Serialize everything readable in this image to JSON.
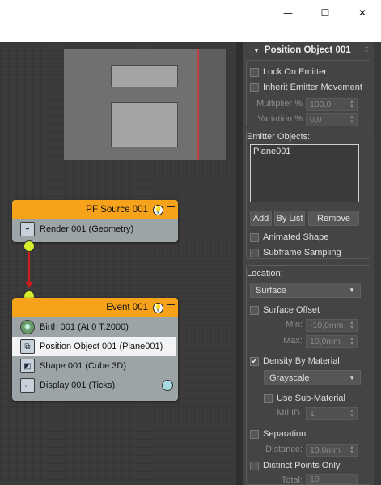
{
  "window": {
    "minimize": "—",
    "maximize": "☐",
    "close": "✕"
  },
  "nodes": {
    "source": {
      "title": "PF Source 001",
      "operators": [
        {
          "icon": "teapot-render-icon",
          "label": "Render 001 (Geometry)"
        }
      ]
    },
    "event": {
      "title": "Event 001",
      "operators": [
        {
          "icon": "birth-icon",
          "label": "Birth 001 (At 0 T:2000)"
        },
        {
          "icon": "position-object-icon",
          "label": "Position Object 001 (Plane001)",
          "selected": true
        },
        {
          "icon": "shape-icon",
          "label": "Shape 001 (Cube 3D)"
        },
        {
          "icon": "display-icon",
          "label": "Display 001 (Ticks)"
        }
      ]
    }
  },
  "panel": {
    "rollout_title": "Position Object 001",
    "lock_on_emitter": "Lock On Emitter",
    "inherit_emitter_movement": "Inherit Emitter Movement",
    "multiplier": {
      "label": "Multiplier %",
      "value": "100,0"
    },
    "variation": {
      "label": "Variation %",
      "value": "0,0"
    },
    "emitter_objects_label": "Emitter Objects:",
    "emitter_objects": [
      "Plane001"
    ],
    "add_button": "Add",
    "by_list_button": "By List",
    "remove_button": "Remove",
    "animated_shape": "Animated Shape",
    "subframe_sampling": "Subframe Sampling",
    "location_label": "Location:",
    "location_value": "Surface",
    "surface_offset": "Surface Offset",
    "min": {
      "label": "Min:",
      "value": "-10,0mm"
    },
    "max": {
      "label": "Max:",
      "value": "10,0mm"
    },
    "density_by_material": {
      "label": "Density By Material",
      "checked": true
    },
    "density_mode": "Grayscale",
    "use_sub_material": "Use Sub-Material",
    "mtl_id": {
      "label": "Mtl ID:",
      "value": "1"
    },
    "separation": "Separation",
    "distance": {
      "label": "Distance:",
      "value": "10,0mm"
    },
    "distinct_points_only": "Distinct Points Only",
    "total": {
      "label": "Total:",
      "value": "10"
    }
  }
}
